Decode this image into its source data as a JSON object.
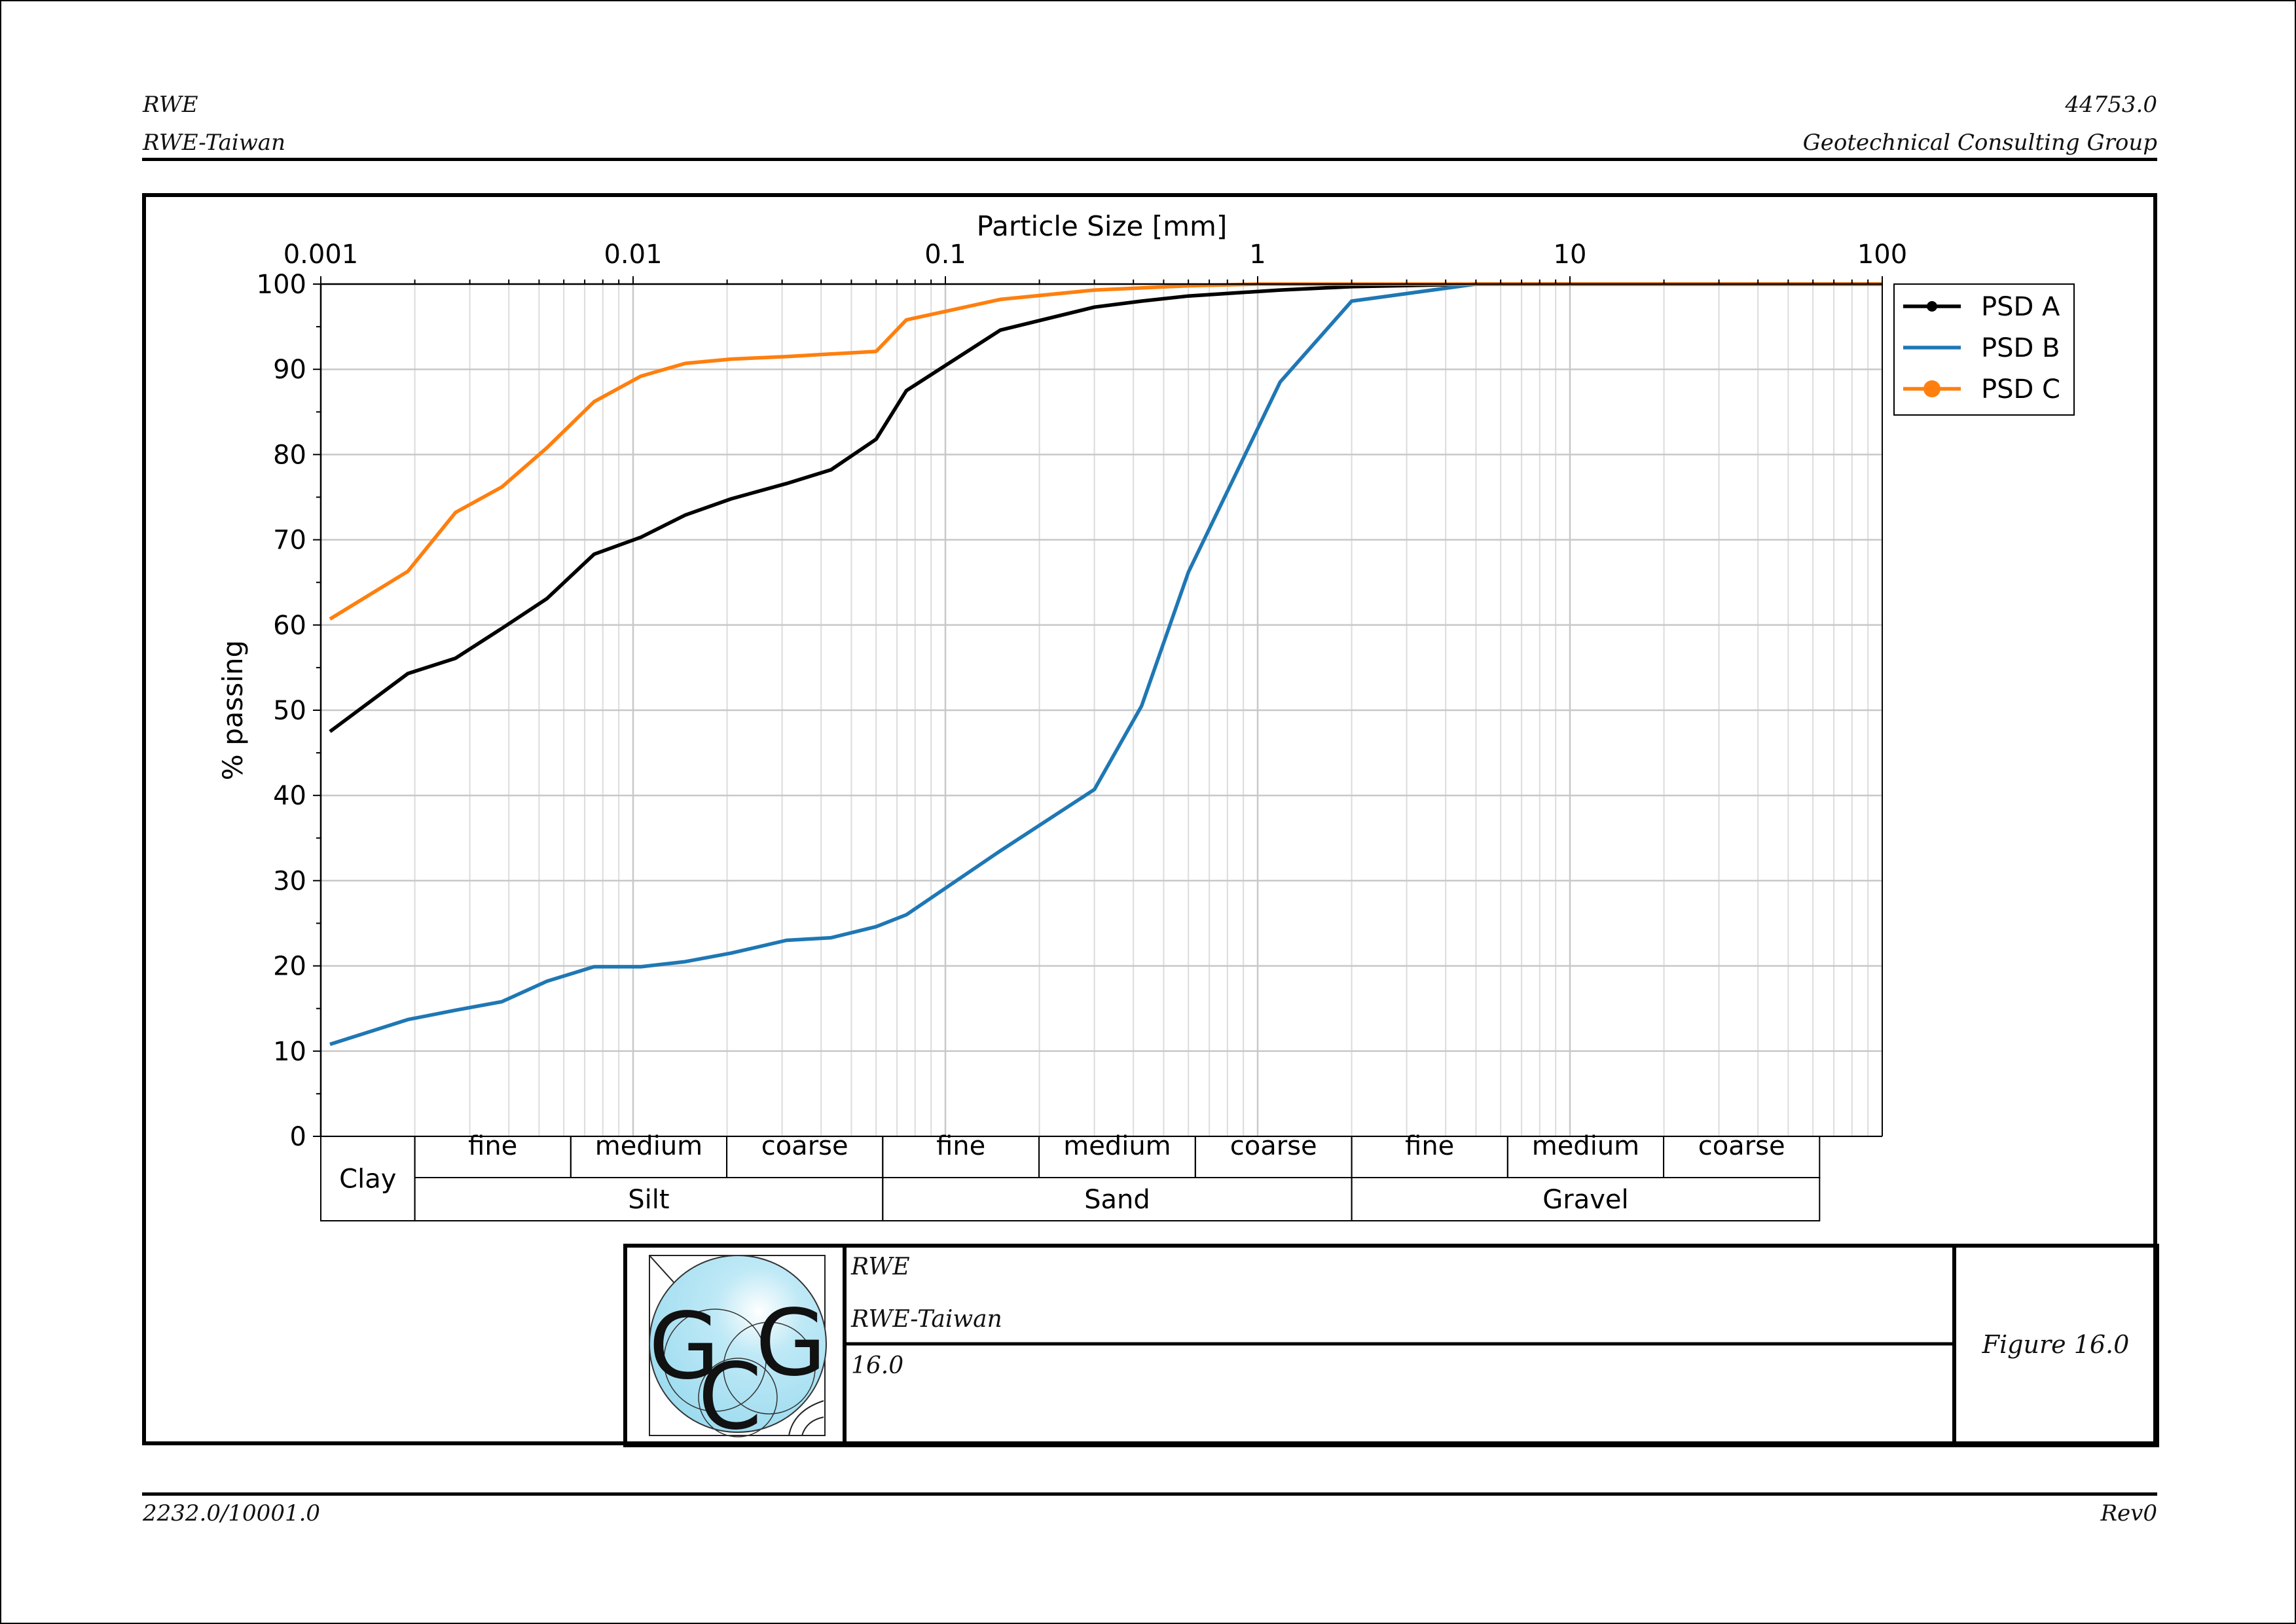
{
  "header": {
    "left_line1": "RWE",
    "left_line2": "RWE-Taiwan",
    "right_line1": "44753.0",
    "right_line2": "Geotechnical Consulting Group"
  },
  "footer": {
    "left": "2232.0/10001.0",
    "right": "Rev0"
  },
  "title_block": {
    "project_line1": "RWE",
    "project_line2": "RWE-Taiwan",
    "number": "16.0",
    "figure": "Figure 16.0",
    "logo_text": "GCG"
  },
  "chart_data": {
    "type": "line",
    "xlabel": "Particle Size [mm]",
    "ylabel": "% passing",
    "x_scale": "log",
    "xlim": [
      0.001,
      100
    ],
    "ylim": [
      0,
      100
    ],
    "x_ticks": [
      "0.001",
      "0.01",
      "0.1",
      "1",
      "10",
      "100"
    ],
    "y_ticks": [
      "0",
      "10",
      "20",
      "30",
      "40",
      "50",
      "60",
      "70",
      "80",
      "90",
      "100"
    ],
    "grid": true,
    "legend_position": "outside-top-right",
    "series": [
      {
        "name": "PSD A",
        "color": "#000000",
        "marker": "dot",
        "x": [
          0.00107,
          0.0019,
          0.0027,
          0.0038,
          0.0053,
          0.0075,
          0.0106,
          0.0147,
          0.0206,
          0.031,
          0.043,
          0.06,
          0.075,
          0.15,
          0.3,
          0.425,
          0.6,
          1.18,
          2.0,
          5.0,
          100
        ],
        "y": [
          47.5,
          54.3,
          56.1,
          59.6,
          63.1,
          68.3,
          70.3,
          72.9,
          74.8,
          76.6,
          78.2,
          81.8,
          87.5,
          94.6,
          97.3,
          98.0,
          98.6,
          99.3,
          99.7,
          100,
          100
        ]
      },
      {
        "name": "PSD B",
        "color": "#1f77b4",
        "marker": "none",
        "x": [
          0.00107,
          0.0019,
          0.0027,
          0.0038,
          0.0053,
          0.0075,
          0.0106,
          0.0147,
          0.0206,
          0.031,
          0.043,
          0.06,
          0.075,
          0.15,
          0.3,
          0.425,
          0.6,
          1.18,
          2.0,
          5.0,
          100
        ],
        "y": [
          10.8,
          13.7,
          14.8,
          15.8,
          18.2,
          19.9,
          19.9,
          20.5,
          21.5,
          23.0,
          23.3,
          24.6,
          26.0,
          33.5,
          40.7,
          50.5,
          66.2,
          88.5,
          98.0,
          100,
          100
        ]
      },
      {
        "name": "PSD C",
        "color": "#ff7f0e",
        "marker": "dot",
        "x": [
          0.00107,
          0.0019,
          0.0027,
          0.0038,
          0.0053,
          0.0075,
          0.0106,
          0.0147,
          0.0206,
          0.031,
          0.043,
          0.06,
          0.075,
          0.15,
          0.3,
          0.6,
          1.0,
          100
        ],
        "y": [
          60.7,
          66.3,
          73.2,
          76.2,
          80.8,
          86.2,
          89.2,
          90.7,
          91.2,
          91.5,
          91.8,
          92.1,
          95.8,
          98.2,
          99.3,
          99.8,
          100,
          100
        ]
      }
    ],
    "soil_classes": {
      "clay": "Clay",
      "groups": [
        {
          "name": "Silt",
          "x_range": [
            0.002,
            0.063
          ],
          "subs": [
            "fine",
            "medium",
            "coarse"
          ]
        },
        {
          "name": "Sand",
          "x_range": [
            0.063,
            2.0
          ],
          "subs": [
            "fine",
            "medium",
            "coarse"
          ]
        },
        {
          "name": "Gravel",
          "x_range": [
            2.0,
            63.0
          ],
          "subs": [
            "fine",
            "medium",
            "coarse"
          ]
        }
      ]
    }
  }
}
